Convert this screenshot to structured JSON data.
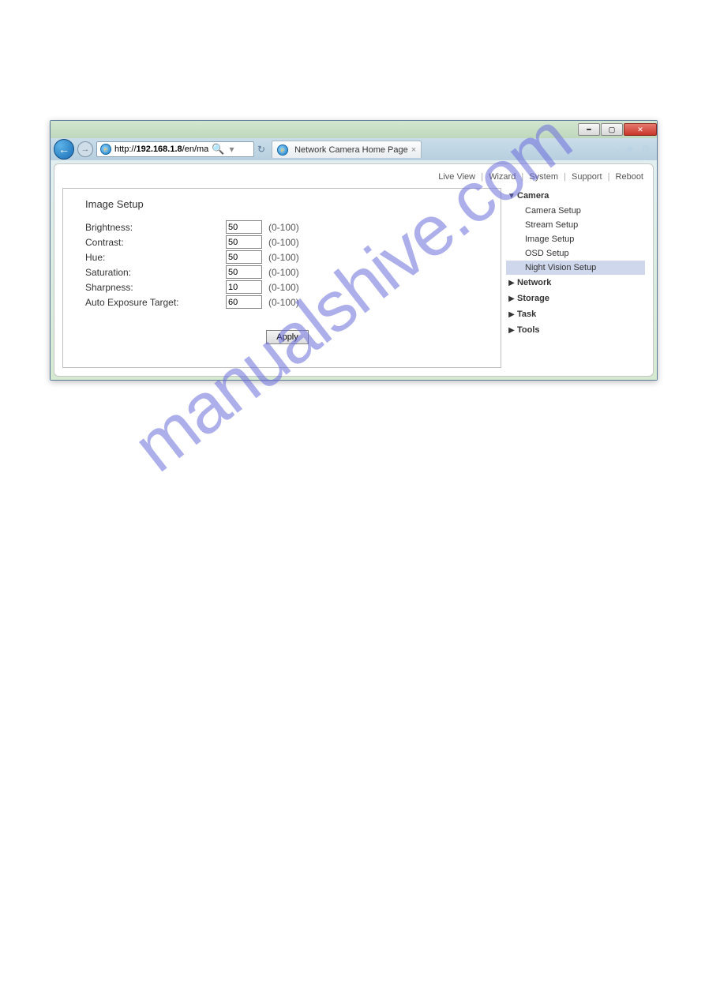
{
  "browser": {
    "address_prefix": "http://",
    "address_host": "192.168.1.8",
    "address_path": "/en/ma",
    "tab_title": "Network Camera Home Page"
  },
  "topnav": {
    "live_view": "Live View",
    "wizard": "Wizard",
    "system": "System",
    "support": "Support",
    "reboot": "Reboot"
  },
  "panel_title": "Image Setup",
  "fields": {
    "brightness": {
      "label": "Brightness:",
      "value": "50",
      "range": "(0-100)"
    },
    "contrast": {
      "label": "Contrast:",
      "value": "50",
      "range": "(0-100)"
    },
    "hue": {
      "label": "Hue:",
      "value": "50",
      "range": "(0-100)"
    },
    "saturation": {
      "label": "Saturation:",
      "value": "50",
      "range": "(0-100)"
    },
    "sharpness": {
      "label": "Sharpness:",
      "value": "10",
      "range": "(0-100)"
    },
    "aet": {
      "label": "Auto Exposure Target:",
      "value": "60",
      "range": "(0-100)"
    }
  },
  "apply_label": "Apply",
  "sidenav": {
    "camera": {
      "label": "Camera",
      "items": {
        "camera_setup": "Camera Setup",
        "stream_setup": "Stream Setup",
        "image_setup": "Image Setup",
        "osd_setup": "OSD Setup",
        "night_vision": "Night Vision Setup"
      }
    },
    "network": "Network",
    "storage": "Storage",
    "task": "Task",
    "tools": "Tools"
  },
  "watermark": "manualshive.com"
}
